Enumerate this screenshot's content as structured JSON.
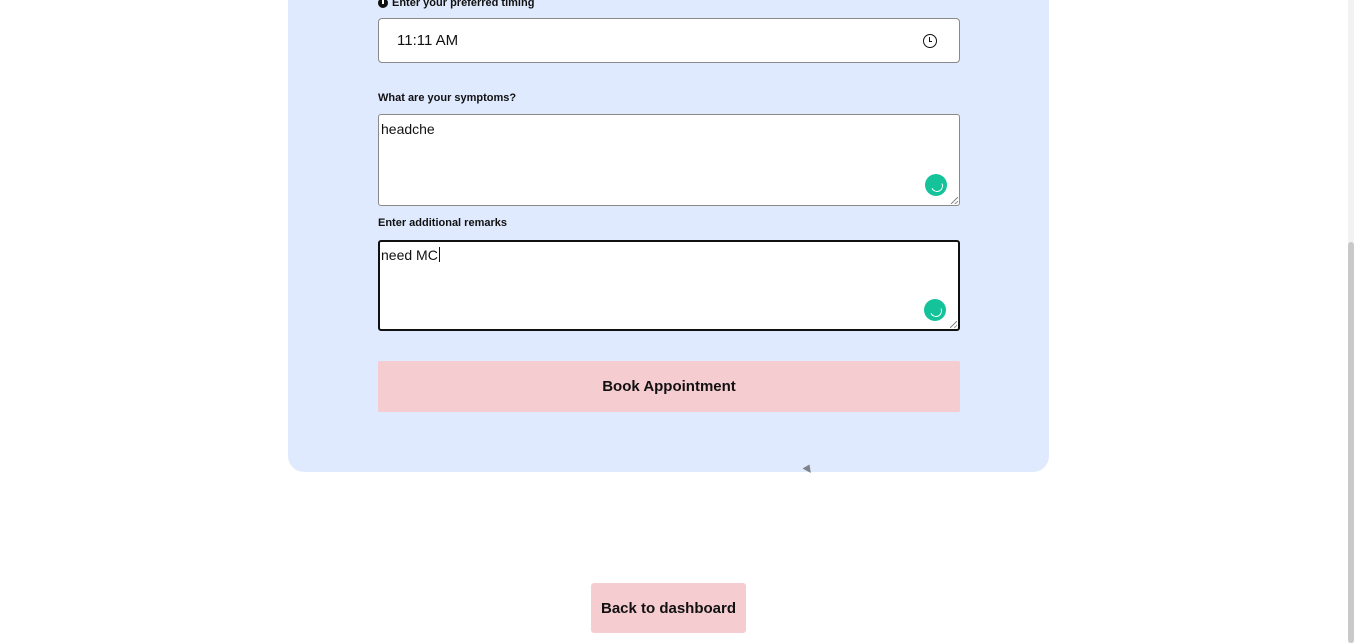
{
  "form": {
    "timing_label": "Enter your preferred timing",
    "timing_value": "11:11  AM",
    "symptoms_label": "What are your symptoms?",
    "symptoms_value": "headche",
    "remarks_label": "Enter additional remarks",
    "remarks_value": "need MC",
    "book_button_label": "Book Appointment"
  },
  "navigation": {
    "back_button_label": "Back to dashboard"
  },
  "icons": {
    "timing_label_icon": "clock-icon",
    "time_picker_icon": "clock-icon",
    "textarea_assistant_icon": "grammarly-icon"
  },
  "colors": {
    "card_background": "#dfeafe",
    "button_background": "#f5ccd0",
    "assistant_icon": "#15c39a"
  }
}
